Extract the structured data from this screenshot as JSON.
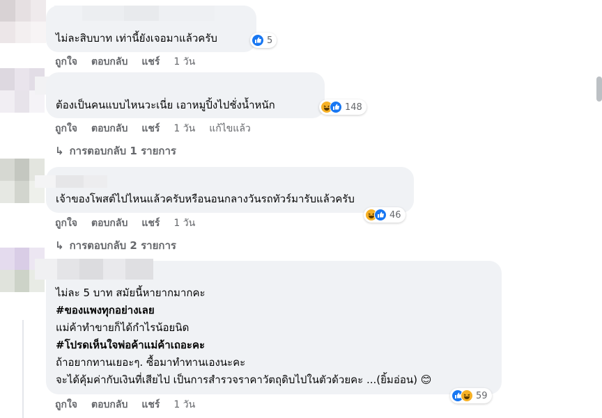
{
  "comments": [
    {
      "text": "ไม่ละสิบบาท เท่านี้ยังเจอมาแล้วครับ",
      "reactions_count": "5",
      "actions": {
        "like": "ถูกใจ",
        "reply": "ตอบกลับ",
        "share": "แชร์",
        "time": "1 วัน"
      }
    },
    {
      "text": "ต้องเป็นคนแบบไหนวะเนี่ย เอาหมูปิ้งไปชั่งน้ำหนัก",
      "reactions_count": "148",
      "actions": {
        "like": "ถูกใจ",
        "reply": "ตอบกลับ",
        "share": "แชร์",
        "time": "1 วัน",
        "edited": "แก้ไขแล้ว"
      },
      "replies_label": "การตอบกลับ 1 รายการ"
    },
    {
      "text": "เจ้าของโพสต์ไปไหนแล้วครับหรือนอนกลางวันรถทัวร์มารับแล้วครับ",
      "reactions_count": "46",
      "actions": {
        "like": "ถูกใจ",
        "reply": "ตอบกลับ",
        "share": "แชร์",
        "time": "1 วัน"
      },
      "replies_label": "การตอบกลับ 2 รายการ"
    },
    {
      "lines": [
        "ไม่ละ 5 บาท สมัยนี้หายากมากคะ",
        "#ของแพงทุกอย่างเลย",
        "แม่ค้าทำขายก็ได้กำไรน้อยนิด",
        "#โปรดเห็นใจพ่อค้าแม่ค้าเถอะคะ",
        "ถ้าอยากทานเยอะๆ. ซื้อมาทำทานเองนะคะ",
        "จะได้คุ้มค่ากับเงินที่เสียไป เป็นการสำรวจราคาวัตถุดิบไปในตัวด้วยคะ ...(ยิ้มอ่อน) 😊"
      ],
      "reactions_count": "59",
      "actions": {
        "like": "ถูกใจ",
        "reply": "ตอบกลับ",
        "share": "แชร์",
        "time": "1 วัน"
      }
    }
  ],
  "icons": {
    "like": "like-reaction-icon",
    "haha": "haha-reaction-icon",
    "reply_arrow": "reply-arrow-icon"
  },
  "colors": {
    "like": "#1877f2",
    "haha": "#f7b125",
    "bubble": "#f0f2f5",
    "meta": "#65676b"
  }
}
